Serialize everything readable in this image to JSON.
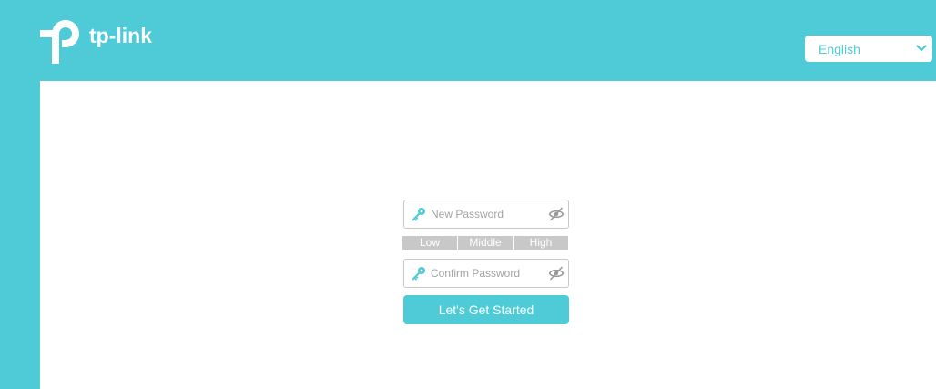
{
  "header": {
    "brand": "tp-link",
    "logo_icon": "tp-link-logo-icon"
  },
  "language": {
    "selected": "English",
    "icon": "chevron-down-icon"
  },
  "form": {
    "new_password": {
      "placeholder": "New Password",
      "value": "",
      "icon": "key-icon",
      "toggle_icon": "eye-slash-icon"
    },
    "strength": {
      "labels": [
        "Low",
        "Middle",
        "High"
      ]
    },
    "confirm_password": {
      "placeholder": "Confirm Password",
      "value": "",
      "icon": "key-icon",
      "toggle_icon": "eye-slash-icon"
    },
    "submit_label": "Let's Get Started"
  },
  "colors": {
    "brand": "#4ecbd6",
    "panel": "#ffffff",
    "strength_inactive": "#c8c8c8"
  }
}
